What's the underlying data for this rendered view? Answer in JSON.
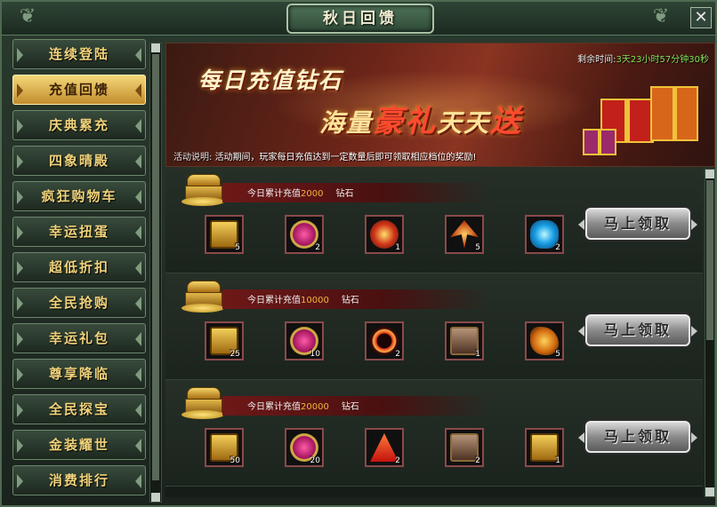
{
  "window": {
    "title": "秋日回馈",
    "close_label": "✕"
  },
  "sidebar": {
    "items": [
      {
        "label": "连续登陆",
        "active": false
      },
      {
        "label": "充值回馈",
        "active": true
      },
      {
        "label": "庆典累充",
        "active": false
      },
      {
        "label": "四象晴殿",
        "active": false
      },
      {
        "label": "疯狂购物车",
        "active": false
      },
      {
        "label": "幸运扭蛋",
        "active": false
      },
      {
        "label": "超低折扣",
        "active": false
      },
      {
        "label": "全民抢购",
        "active": false
      },
      {
        "label": "幸运礼包",
        "active": false
      },
      {
        "label": "尊享降临",
        "active": false
      },
      {
        "label": "全民探宝",
        "active": false
      },
      {
        "label": "金装耀世",
        "active": false
      },
      {
        "label": "消费排行",
        "active": false
      }
    ]
  },
  "banner": {
    "headline1": "每日充值钻石",
    "headline2_a": "海量",
    "headline2_b": "豪礼",
    "headline2_c": "天天",
    "headline2_d": "送",
    "timer_label": "剩余时间:",
    "timer_value": "3天23小时57分钟30秒",
    "desc_label": "活动说明:",
    "desc_text": "活动期间，玩家每日充值达到一定数量后即可领取相应档位的奖励!"
  },
  "tiers": [
    {
      "prefix": "今日累计充值",
      "amount": "2000",
      "suffix": "钻石",
      "button": "马上领取",
      "items": [
        {
          "icon": "treasure-box-icon",
          "count": "5"
        },
        {
          "icon": "pink-gem-icon",
          "count": "2"
        },
        {
          "icon": "fire-orb-icon",
          "count": "1"
        },
        {
          "icon": "phoenix-icon",
          "count": "5"
        },
        {
          "icon": "blue-crystal-icon",
          "count": "2"
        }
      ]
    },
    {
      "prefix": "今日累计充值",
      "amount": "10000",
      "suffix": "钻石",
      "button": "马上领取",
      "items": [
        {
          "icon": "treasure-box-icon",
          "count": "25"
        },
        {
          "icon": "pink-gem-icon",
          "count": "10"
        },
        {
          "icon": "fire-ring-icon",
          "count": "2"
        },
        {
          "icon": "iron-chest-icon",
          "count": "1"
        },
        {
          "icon": "dragon-icon",
          "count": "5"
        }
      ]
    },
    {
      "prefix": "今日累计充值",
      "amount": "20000",
      "suffix": "钻石",
      "button": "马上领取",
      "items": [
        {
          "icon": "treasure-box-icon",
          "count": "50"
        },
        {
          "icon": "pink-gem-icon",
          "count": "20"
        },
        {
          "icon": "red-triangle-icon",
          "count": "2"
        },
        {
          "icon": "iron-chest-icon",
          "count": "2"
        },
        {
          "icon": "gold-chest-icon",
          "count": "1"
        }
      ]
    }
  ]
}
